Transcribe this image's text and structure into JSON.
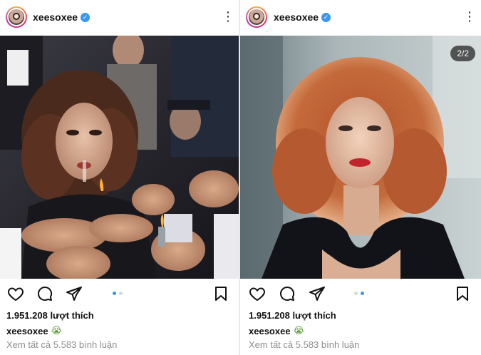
{
  "posts": [
    {
      "username": "xeesoxee",
      "verified_mark": "✓",
      "more_icon": "⋮",
      "counter": "",
      "image_desc": "woman-lighting-cigarettes-scene",
      "likes": "1.951.208 lượt thích",
      "caption_user": "xeesoxee",
      "caption_emoji": "😭",
      "comments_link": "Xem tất cả 5.583 bình luận",
      "carousel_active": 0
    },
    {
      "username": "xeesoxee",
      "verified_mark": "✓",
      "more_icon": "⋮",
      "counter": "2/2",
      "image_desc": "woman-portrait-red-hair",
      "likes": "1.951.208 lượt thích",
      "caption_user": "xeesoxee",
      "caption_emoji": "😭",
      "comments_link": "Xem tất cả 5.583 bình luận",
      "carousel_active": 1
    }
  ],
  "icons": [
    "heart-icon",
    "comment-icon",
    "share-icon",
    "bookmark-icon",
    "verified-icon",
    "more-options-icon"
  ],
  "colors": {
    "accent": "#3897f0",
    "muted_text": "#8e8e8e",
    "text": "#111111"
  }
}
